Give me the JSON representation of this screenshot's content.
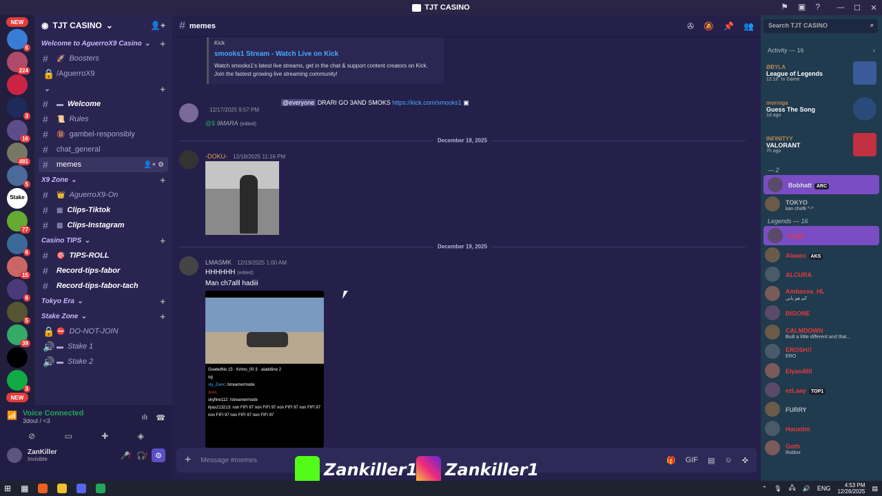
{
  "window": {
    "title": "TJT CASINO"
  },
  "servers": [
    {
      "badge": "NEW",
      "type": "new"
    },
    {
      "badge": "6",
      "color": "#3a7bd5"
    },
    {
      "badge": "224",
      "color": "#b04a6a"
    },
    {
      "badge": "",
      "color": "#c24"
    },
    {
      "badge": "3",
      "color": "#1e2a5a"
    },
    {
      "badge": "16",
      "color": "#5d4b8a"
    },
    {
      "badge": "481",
      "color": "#776"
    },
    {
      "badge": "5",
      "color": "#4a6a9a"
    },
    {
      "badge": "",
      "label": "Stake",
      "color": "#fff"
    },
    {
      "badge": "77",
      "color": "#6a3"
    },
    {
      "badge": "6",
      "color": "#3a6a9a"
    },
    {
      "badge": "15",
      "color": "#c66"
    },
    {
      "badge": "6",
      "color": "#4a3a7a"
    },
    {
      "badge": "5",
      "color": "#553"
    },
    {
      "badge": "39",
      "color": "#3a6"
    },
    {
      "badge": "",
      "color": "#000"
    },
    {
      "badge": "3",
      "color": "#1a4"
    },
    {
      "badge": "NEW",
      "type": "new"
    }
  ],
  "sidebar": {
    "server_name": "TJT CASINO",
    "categories": [
      {
        "label": "Welcome to AguerroX9 Casino",
        "channels": [
          {
            "icon": "#",
            "name": "Boosters",
            "emoji": "🚀",
            "italic": true
          },
          {
            "icon": "🔒",
            "name": "/AguerroX9",
            "italic": false
          }
        ]
      },
      {
        "label": "",
        "channels": [
          {
            "icon": "#",
            "name": "Welcome",
            "emoji": "▬",
            "italic": true,
            "bold": true
          },
          {
            "icon": "#",
            "name": "Rules",
            "emoji": "📜",
            "italic": true
          },
          {
            "icon": "#",
            "name": "gambel-responsibly",
            "emoji": "🔞",
            "italic": false
          },
          {
            "icon": "#",
            "name": "chat_general",
            "emoji": "",
            "italic": false
          },
          {
            "icon": "#",
            "name": "memes",
            "emoji": "",
            "italic": false,
            "active": true
          }
        ]
      },
      {
        "label": "X9 Zone",
        "channels": [
          {
            "icon": "#",
            "name": "AguerroX9-On",
            "emoji": "👑",
            "italic": true
          },
          {
            "icon": "#",
            "name": "Clips-Tiktok",
            "emoji": "▦",
            "italic": true,
            "bold": true
          },
          {
            "icon": "#",
            "name": "Clips-Instagram",
            "emoji": "▩",
            "italic": true,
            "bold": true
          }
        ]
      },
      {
        "label": "Casino TIPS",
        "channels": [
          {
            "icon": "#",
            "name": "TIPS-ROLL",
            "emoji": "🎯",
            "italic": true,
            "bold": true
          },
          {
            "icon": "#",
            "name": "Record-tips-fabor",
            "emoji": "",
            "italic": true,
            "bold": true
          },
          {
            "icon": "#",
            "name": "Record-tips-fabor-tach",
            "emoji": "",
            "italic": true,
            "bold": true
          }
        ]
      },
      {
        "label": "Tokyo Era",
        "channels": []
      },
      {
        "label": "Stake Zone",
        "channels": [
          {
            "icon": "🔒",
            "name": "DO-NOT-JOIN",
            "emoji": "⛔",
            "italic": true
          },
          {
            "icon": "🔊",
            "name": "Stake 1",
            "emoji": "▬",
            "italic": true
          },
          {
            "icon": "🔊",
            "name": "Stake 2",
            "emoji": "▬",
            "italic": true
          }
        ]
      }
    ]
  },
  "voice": {
    "status": "Voice Connected",
    "channel": "3doul / <3"
  },
  "user": {
    "name": "ZanKiller",
    "status": "Invisible"
  },
  "main": {
    "channel": "memes",
    "embed": {
      "provider": "Kick",
      "title": "smooks1 Stream - Watch Live on Kick",
      "desc": "Watch smooks1's latest live streams, get in the chat & support content creators on Kick. Join the fastest growing live streaming community!"
    },
    "msg1": {
      "author": "",
      "time": "12/17/2025 9:57 PM",
      "mention": "@everyone",
      "text": "DRARI GO 3AND SMOKS",
      "link": "https://kick.com/smooks1",
      "line2": "9MARA",
      "edited": "(edited)"
    },
    "div1": "December 18, 2025",
    "msg2": {
      "author": "-DOKU-",
      "time": "12/18/2025 11:16 PM"
    },
    "div2": "December 19, 2025",
    "msg3": {
      "author": "LMASMK",
      "time": "12/19/2025 1:00 AM",
      "line1": "HHHHHH",
      "edited": "(edited)",
      "line2": "Man ch7alll hadiii"
    },
    "composer": "Message #memes"
  },
  "search": {
    "placeholder": "Search TJT CASINO"
  },
  "members": {
    "activity": "Activity — 16",
    "cards": [
      {
        "user": "ØBYLA",
        "game": "League of Legends",
        "time": "12:16",
        "extra": "In Game"
      },
      {
        "user": "morniga",
        "game": "Guess The Song",
        "time": "1d ago",
        "extra": ""
      },
      {
        "user": "INFINITYY",
        "game": "VALORANT",
        "time": "7h ago",
        "extra": ""
      }
    ],
    "group1": "— 2",
    "g1": [
      {
        "name": "Bobhatt",
        "tag": "ARC",
        "color": "#dbdee1",
        "hl": true
      },
      {
        "name": "TOKYO",
        "sub": "kan chofk ^-^",
        "color": "#b5bac1"
      }
    ],
    "group2": "Legends — 16",
    "g2": [
      {
        "name": "l7allil",
        "color": "#e23c3c",
        "hl": true
      },
      {
        "name": "Alaaeo",
        "tag": "AKS",
        "color": "#e23c3c"
      },
      {
        "name": "ALCURA",
        "color": "#e23c3c"
      },
      {
        "name": "Ambassa_HL",
        "sub": "كم هو بابي",
        "color": "#e23c3c"
      },
      {
        "name": "BIGONE",
        "color": "#e23c3c"
      },
      {
        "name": "CALMDOWN",
        "sub": "Built a little different and that...",
        "color": "#e23c3c"
      },
      {
        "name": "EROSH!!",
        "sub": "ERO",
        "color": "#e23c3c"
      },
      {
        "name": "Elyas4llll",
        "color": "#e23c3c"
      },
      {
        "name": "ezLaay",
        "tag": "TOP1",
        "color": "#e23c3c"
      },
      {
        "name": "FURRY",
        "color": "#b5bac1"
      },
      {
        "name": "Haustini",
        "color": "#e23c3c"
      },
      {
        "name": "Goth",
        "sub": "Roblox",
        "color": "#e23c3c"
      }
    ]
  },
  "overlay": {
    "kick": "Zankiller1",
    "insta": "Zankiller1"
  },
  "taskbar": {
    "lang": "ENG",
    "time": "4:53 PM",
    "date": "12/26/2025"
  }
}
